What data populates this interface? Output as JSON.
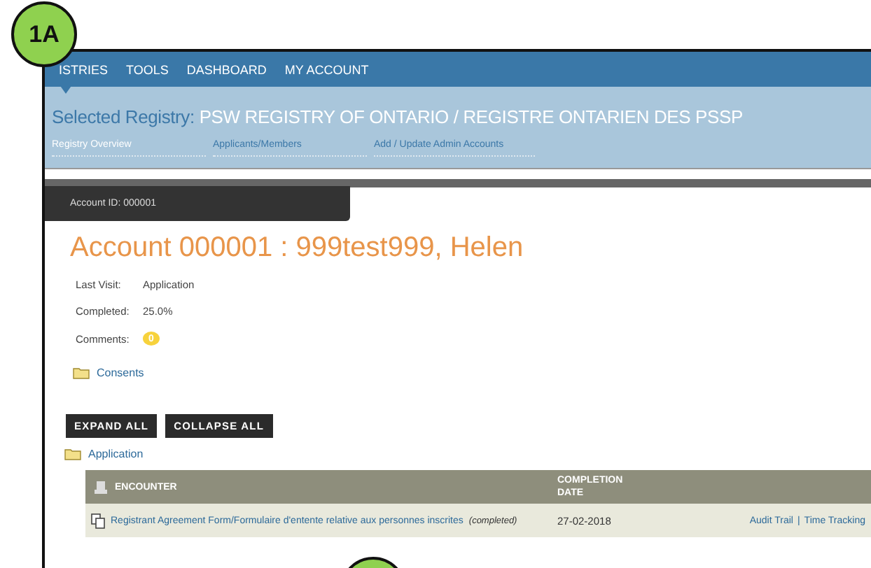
{
  "badge": {
    "label": "1A"
  },
  "nav": {
    "items": [
      {
        "label": "ISTRIES",
        "selected": true
      },
      {
        "label": "TOOLS",
        "selected": false
      },
      {
        "label": "DASHBOARD",
        "selected": false
      },
      {
        "label": "MY ACCOUNT",
        "selected": false
      }
    ]
  },
  "registry": {
    "label": "Selected Registry:",
    "name": "PSW REGISTRY OF ONTARIO / REGISTRE ONTARIEN DES PSSP"
  },
  "subtabs": [
    {
      "label": "Registry Overview",
      "selected": true
    },
    {
      "label": "Applicants/Members",
      "selected": false
    },
    {
      "label": "Add / Update Admin Accounts",
      "selected": false
    }
  ],
  "account_tab": "Account ID: 000001",
  "account_title": "Account 000001 : 999test999, Helen",
  "info": [
    {
      "label": "Last Visit:",
      "value": "Application"
    },
    {
      "label": "Completed:",
      "value": "25.0%"
    },
    {
      "label": "Comments:",
      "value": "0",
      "kind": "bubble"
    }
  ],
  "consents": "Consents",
  "buttons": [
    "EXPAND ALL",
    "COLLAPSE ALL"
  ],
  "application": "Application",
  "table": {
    "columns": [
      "ENCOUNTER",
      "COMPLETION DATE"
    ],
    "rows": [
      {
        "form": "Registrant Agreement Form/Formulaire d'entente relative aux personnes inscrites",
        "status": "(completed)",
        "date": "27-02-2018",
        "links": [
          "Audit Trail",
          "Time Tracking"
        ],
        "separator": "|"
      }
    ]
  }
}
